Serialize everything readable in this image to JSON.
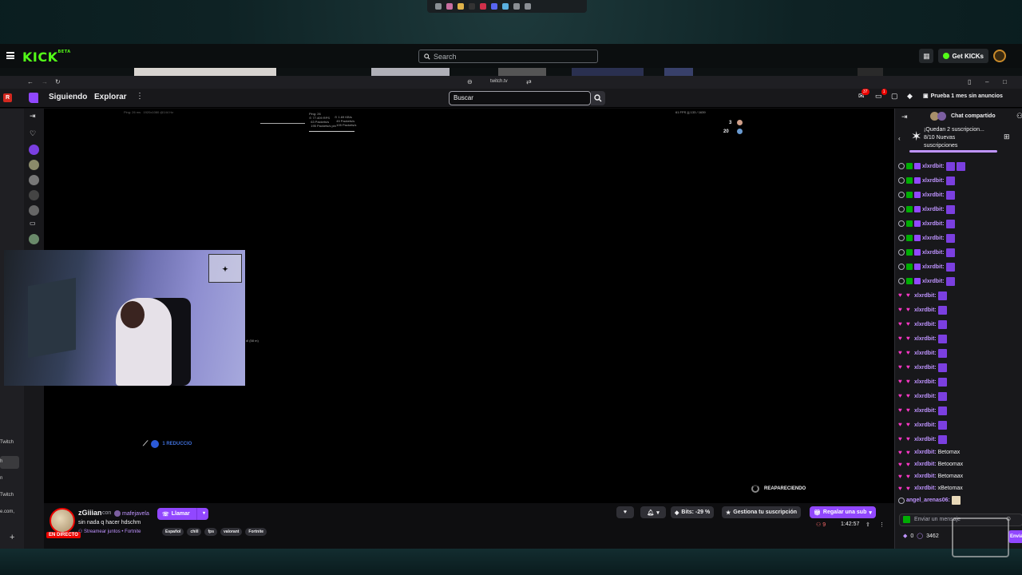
{
  "kick": {
    "logo": "KICK",
    "logo_sup": "BETA",
    "search_placeholder": "Search",
    "get_kicks": "Get KICKs"
  },
  "twitch": {
    "url": "twitch.tv",
    "nav": {
      "following": "Siguiendo",
      "explore": "Explorar",
      "search_placeholder": "Buscar"
    },
    "notif_counts": [
      "37",
      "1"
    ],
    "promo": "Prueba 1 mes sin anuncios",
    "sidebar_texts": [
      "Twitch",
      "h",
      "n",
      "Twitch",
      "e.com,"
    ],
    "player": {
      "stats_top_right": [
        "3",
        "20"
      ],
      "reappearing": "REAPARECIENDO",
      "reduction": "1 REDUCCIO",
      "fps": "61 FPS ||| 133 / 1639"
    },
    "channel": {
      "name": "zGiiian",
      "con": "con",
      "cohost": "mafejavela",
      "call_button": "Llamar",
      "title": "sin nada q hacer hdschm",
      "live_badge": "EN DIRECTO",
      "category": "Streamear juntos • Fortnite",
      "tags": [
        "Español",
        "chill",
        "fps",
        "valorant",
        "Fortnite"
      ],
      "bits": "Bits: -29 %",
      "manage_sub": "Gestiona tu suscripción",
      "gift_sub": "Regalar una sub",
      "viewers": "9",
      "uptime": "1:42:57"
    },
    "chat": {
      "title": "Chat compartido",
      "sub_goal_1": "¡Quedan 2 suscripcion...",
      "sub_goal_2": "8/10 Nuevas",
      "sub_goal_3": "suscripciones",
      "messages": [
        {
          "user": "xlxrdbit:",
          "text": "",
          "style": "a"
        },
        {
          "user": "xlxrdbit:",
          "text": "",
          "style": "a"
        },
        {
          "user": "xlxrdbit:",
          "text": "",
          "style": "a"
        },
        {
          "user": "xlxrdbit:",
          "text": "",
          "style": "a"
        },
        {
          "user": "xlxrdbit:",
          "text": "",
          "style": "a"
        },
        {
          "user": "xlxrdbit:",
          "text": "",
          "style": "a"
        },
        {
          "user": "xlxrdbit:",
          "text": "",
          "style": "a"
        },
        {
          "user": "xlxrdbit:",
          "text": "",
          "style": "a"
        },
        {
          "user": "xlxrdbit:",
          "text": "",
          "style": "a"
        },
        {
          "user": "xlxrdbit:",
          "text": "",
          "style": "b"
        },
        {
          "user": "xlxrdbit:",
          "text": "",
          "style": "b"
        },
        {
          "user": "xlxrdbit:",
          "text": "",
          "style": "b"
        },
        {
          "user": "xlxrdbit:",
          "text": "",
          "style": "b"
        },
        {
          "user": "xlxrdbit:",
          "text": "",
          "style": "b"
        },
        {
          "user": "xlxrdbit:",
          "text": "",
          "style": "b"
        },
        {
          "user": "xlxrdbit:",
          "text": "",
          "style": "b"
        },
        {
          "user": "xlxrdbit:",
          "text": "",
          "style": "b"
        },
        {
          "user": "xlxrdbit:",
          "text": "",
          "style": "b"
        },
        {
          "user": "xlxrdbit:",
          "text": "",
          "style": "b"
        },
        {
          "user": "xlxrdbit:",
          "text": "",
          "style": "b"
        },
        {
          "user": "xlxrdbit:",
          "text": "Betomax",
          "style": "c"
        },
        {
          "user": "xlxrdbit:",
          "text": "Betoomax",
          "style": "c"
        },
        {
          "user": "xlxrdbit:",
          "text": "Betomaax",
          "style": "c"
        },
        {
          "user": "xlxrdbit:",
          "text": "xBetomax",
          "style": "c"
        },
        {
          "user": "angel_arenas06:",
          "text": "",
          "style": "d"
        }
      ],
      "input_placeholder": "Enviar un mensaje",
      "points": "0",
      "channel_points": "3462",
      "send": "Enviar"
    }
  }
}
